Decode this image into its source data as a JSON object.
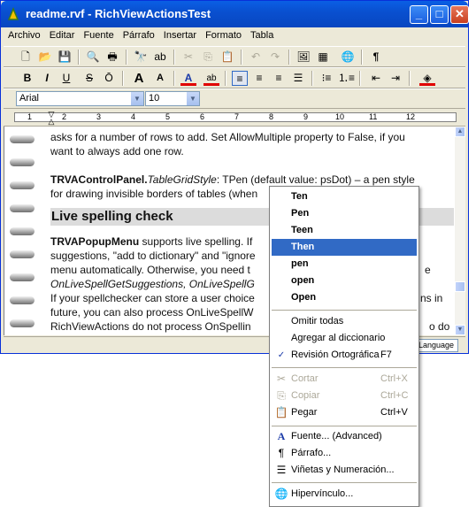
{
  "window": {
    "title": "readme.rvf - RichViewActionsTest",
    "controls": {
      "minimize": "_",
      "maximize": "□",
      "close": "✕"
    }
  },
  "menubar": [
    "Archivo",
    "Editar",
    "Fuente",
    "Párrafo",
    "Insertar",
    "Formato",
    "Tabla"
  ],
  "toolbar1": {
    "icons": [
      "new-icon",
      "open-icon",
      "save-icon",
      "print-preview-icon",
      "print-icon",
      "find-icon",
      "find-replace-icon",
      "cut-icon",
      "copy-icon",
      "paste-icon",
      "undo-icon",
      "redo-icon",
      "insert-picture-icon",
      "insert-table-icon",
      "hyperlink-icon",
      "show-special-chars-icon"
    ],
    "pilcrow": "¶"
  },
  "toolbar2": {
    "bold": "B",
    "italic": "I",
    "underline": "U",
    "strike": "S",
    "overline": "Ō",
    "grow_font": "A",
    "shrink_font": "A",
    "font_color": "A",
    "highlight": "ab"
  },
  "toolbar3": {
    "font": "Arial",
    "size": "10"
  },
  "ruler": {
    "marks": [
      "1",
      "2",
      "3",
      "4",
      "5",
      "6",
      "7",
      "8",
      "9",
      "10",
      "11",
      "12"
    ]
  },
  "document": {
    "lines": [
      "asks for a number of rows to add. Set AllowMultiple property to False, if you",
      "want to always add one row."
    ],
    "para2": {
      "bold": "TRVAControlPanel.",
      "italic": "TableGridStyle",
      "rest": ": TPen (default value: psDot) – a pen style",
      "line2": "for drawing invisible borders of tables (when"
    },
    "heading": "Live spelling check",
    "para3": [
      {
        "bold": "TRVAPopupMenu",
        "text": " supports live spelling. If"
      },
      {
        "text": "suggestions, \"add to dictionary\" and \"ignore"
      },
      {
        "text": "menu automatically. Otherwise, you need t"
      },
      {
        "text": "OnLiveSpellGetSuggestions, OnLiveSpellG"
      },
      {
        "text": "If your spellchecker can store a user choice"
      },
      {
        "text": "future, you can also process OnLiveSpellW"
      },
      {
        "text": "RichViewActions do not process OnSpellin"
      }
    ],
    "tail_right": [
      "e",
      "ns in",
      "o do"
    ]
  },
  "status": {
    "language_button": "Language"
  },
  "context_menu": {
    "suggestions": [
      "Ten",
      "Pen",
      "Teen",
      "Then",
      "pen",
      "open",
      "Open"
    ],
    "selected_suggestion": "Then",
    "spell_items": [
      {
        "label": "Omitir todas",
        "shortcut": ""
      },
      {
        "label": "Agregar al diccionario",
        "shortcut": ""
      },
      {
        "label": "Revisión Ortográfica",
        "shortcut": "F7",
        "icon": "spellcheck-icon"
      }
    ],
    "edit_items": [
      {
        "label": "Cortar",
        "shortcut": "Ctrl+X",
        "icon": "cut-icon",
        "disabled": true
      },
      {
        "label": "Pegar",
        "shortcut": "Ctrl+V",
        "icon": "paste-icon",
        "disabled": false
      },
      {
        "label": "Copiar",
        "shortcut": "Ctrl+C",
        "icon": "copy-icon",
        "disabled": true
      }
    ],
    "format_items": [
      {
        "label": "Fuente... (Advanced)",
        "icon": "font-icon"
      },
      {
        "label": "Párrafo...",
        "icon": "paragraph-icon"
      },
      {
        "label": "Viñetas y Numeración...",
        "icon": "bullets-icon"
      }
    ],
    "link_item": {
      "label": "Hipervínculo...",
      "icon": "hyperlink-icon"
    }
  }
}
